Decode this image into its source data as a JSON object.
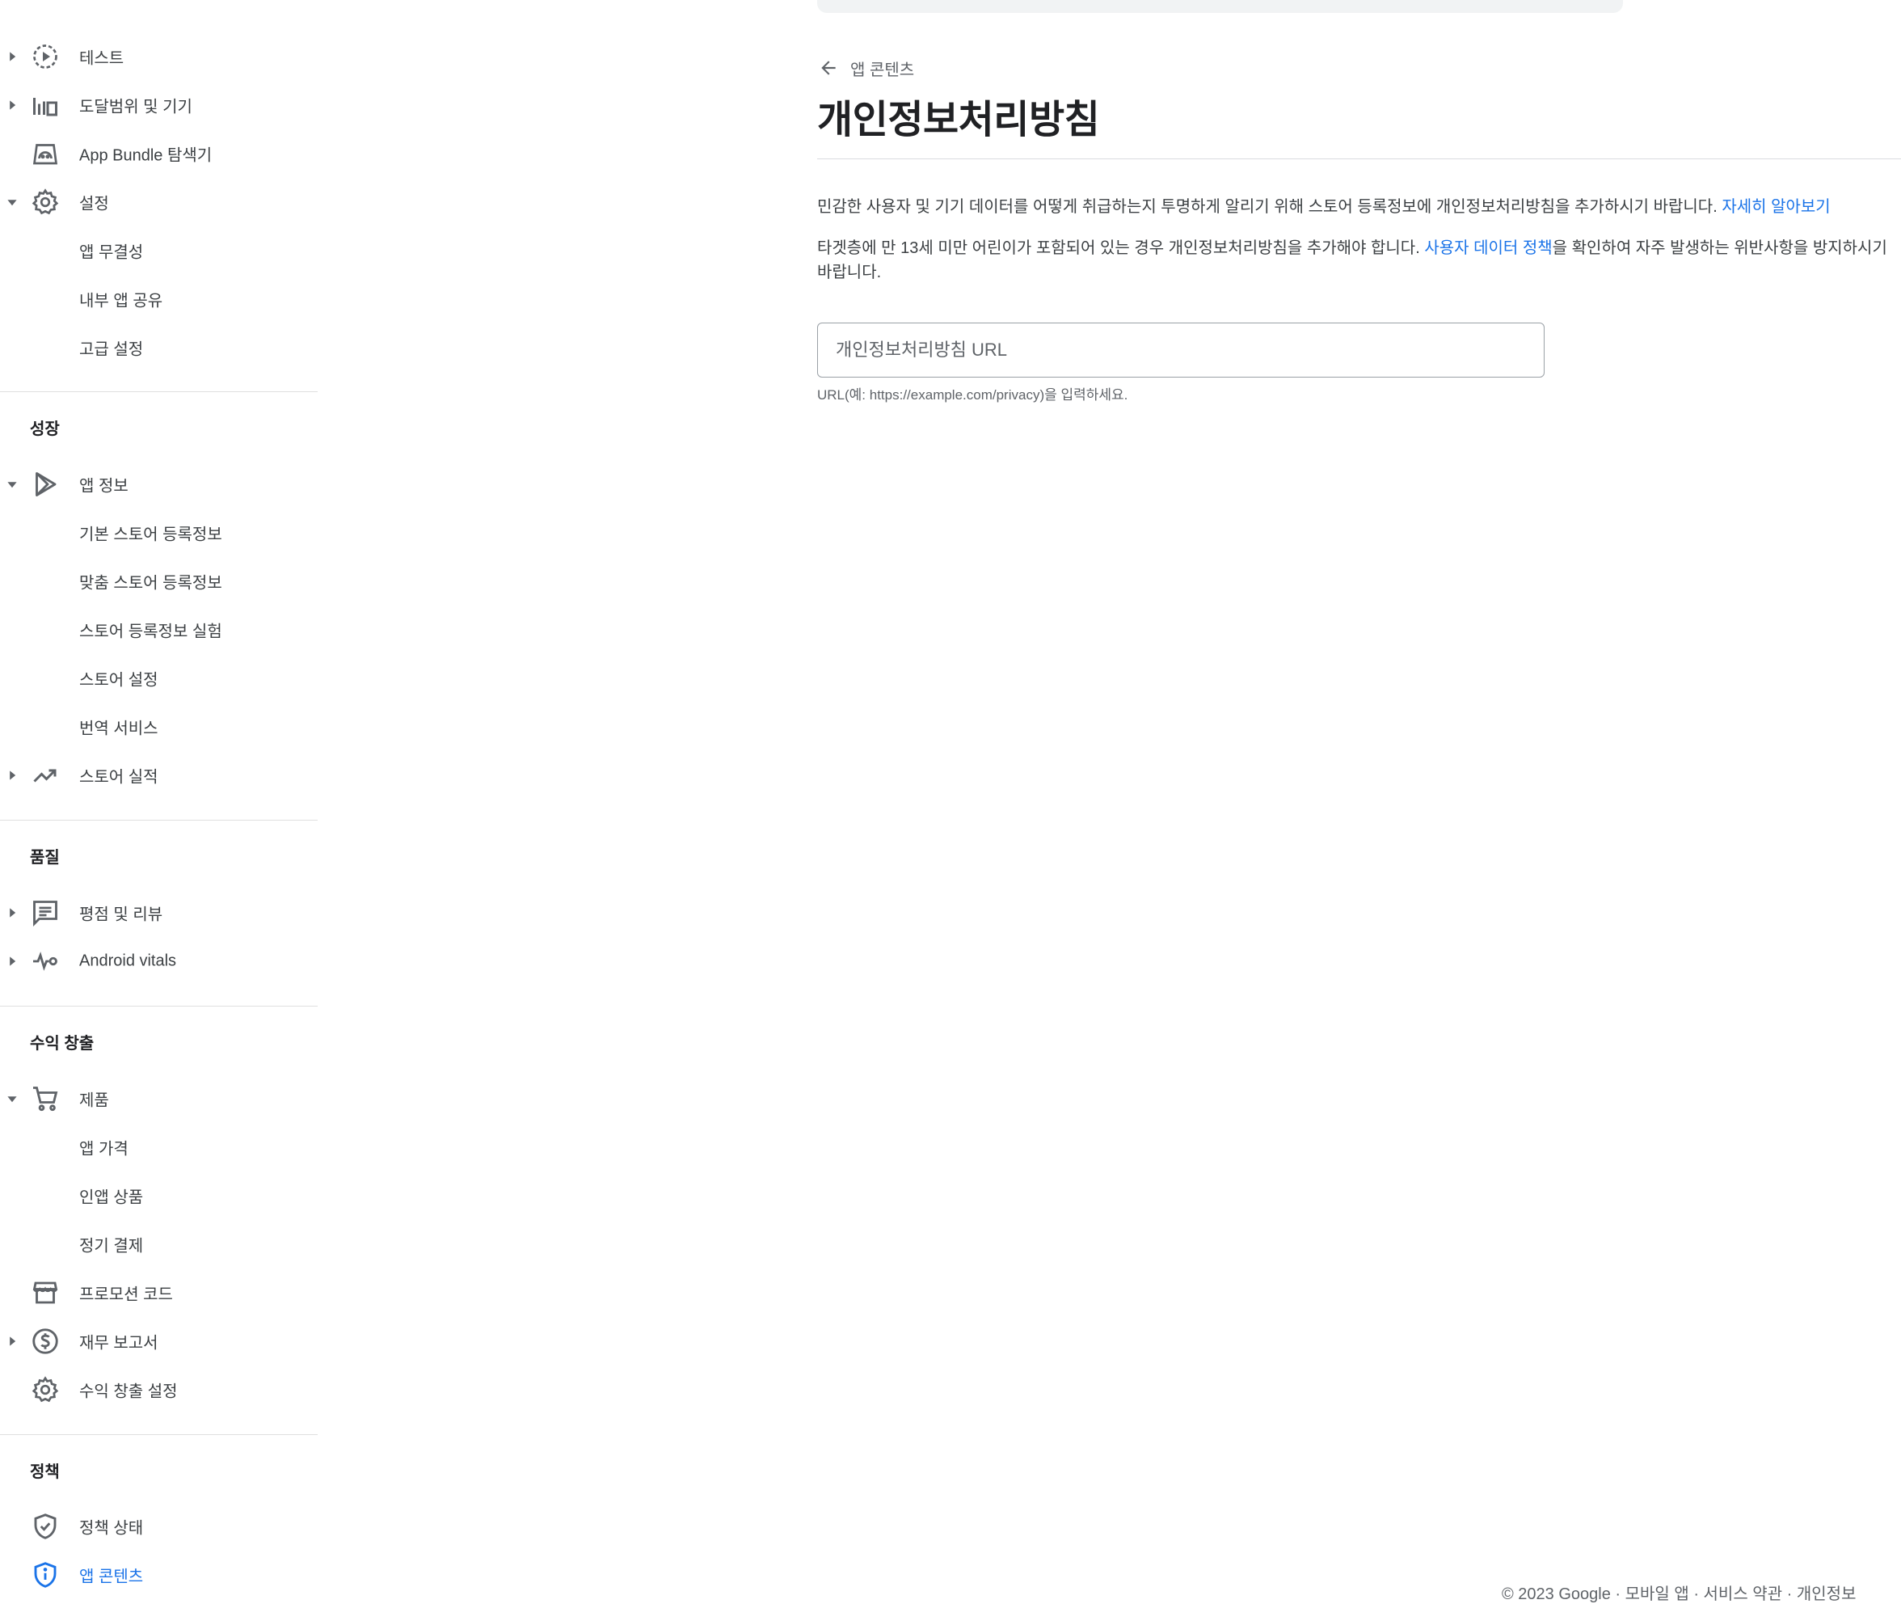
{
  "sidebar": {
    "items": {
      "test": "테스트",
      "reach": "도달범위 및 기기",
      "bundle": "App Bundle 탐색기",
      "settings": "설정",
      "integrity": "앱 무결성",
      "internal_share": "내부 앱 공유",
      "advanced": "고급 설정",
      "app_info": "앱 정보",
      "main_listing": "기본 스토어 등록정보",
      "custom_listing": "맞춤 스토어 등록정보",
      "listing_experiments": "스토어 등록정보 실험",
      "store_settings": "스토어 설정",
      "translation": "번역 서비스",
      "store_performance": "스토어 실적",
      "ratings": "평점 및 리뷰",
      "vitals": "Android vitals",
      "products": "제품",
      "app_pricing": "앱 가격",
      "inapp": "인앱 상품",
      "subscriptions": "정기 결제",
      "promo": "프로모션 코드",
      "financial": "재무 보고서",
      "monetization_setup": "수익 창출 설정",
      "policy_status": "정책 상태",
      "app_content": "앱 콘텐츠"
    },
    "sections": {
      "growth": "성장",
      "quality": "품질",
      "monetize": "수익 창출",
      "policy": "정책"
    },
    "active_color": "#1a73e8"
  },
  "main": {
    "breadcrumb": "앱 콘텐츠",
    "title": "개인정보처리방침",
    "desc1_text": "민감한 사용자 및 기기 데이터를 어떻게 취급하는지 투명하게 알리기 위해 스토어 등록정보에 개인정보처리방침을 추가하시기 바랍니다. ",
    "desc1_link": "자세히 알아보기",
    "desc2_before": "타겟층에 만 13세 미만 어린이가 포함되어 있는 경우 개인정보처리방침을 추가해야 합니다. ",
    "desc2_link": "사용자 데이터 정책",
    "desc2_after": "을 확인하여 자주 발생하는 위반사항을 방지하시기 바랍니다.",
    "url_field": {
      "placeholder": "개인정보처리방침 URL",
      "value": ""
    },
    "helper": "URL(예: https://example.com/privacy)을 입력하세요."
  },
  "footer": {
    "text": "© 2023 Google · 모바일 앱 · 서비스 약관 · 개인정보"
  }
}
